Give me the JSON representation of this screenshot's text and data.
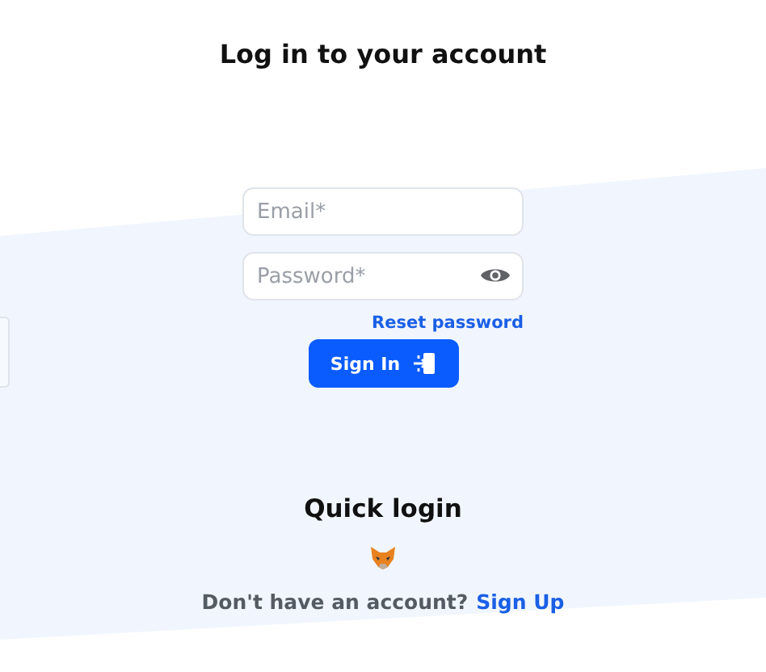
{
  "title": "Log in to your account",
  "fields": [
    {
      "kind": "email",
      "placeholder": "Email*"
    },
    {
      "kind": "password",
      "placeholder": "Password*"
    }
  ],
  "reset_link": "Reset password",
  "sign_in_button": "Sign In",
  "quick_login": {
    "title": "Quick login"
  },
  "signup": {
    "prompt": "Don't have an account?",
    "link": "Sign Up"
  }
}
